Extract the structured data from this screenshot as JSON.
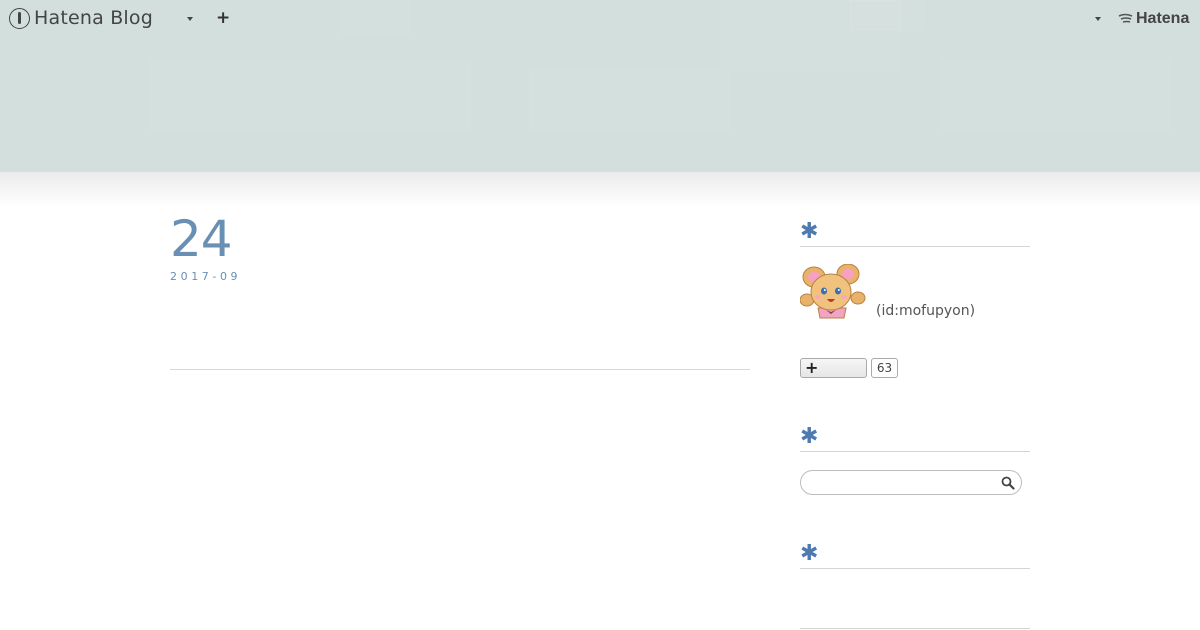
{
  "globalbar": {
    "logo_text": "Hatena Blog",
    "plus_label": "+",
    "brand_text": "Hatena"
  },
  "entry": {
    "day": "24",
    "year_month": "2017-09"
  },
  "profile": {
    "id_text": "(id:mofupyon)",
    "follow_label": "+",
    "follow_count": "63"
  },
  "search": {
    "value": "",
    "placeholder": ""
  },
  "colors": {
    "header_bg": "#d2dfdd",
    "accent": "#6a8fb5",
    "asterisk": "#4d7bb0"
  },
  "icons": [
    "hatena-blog-logo-icon",
    "caret-down-icon",
    "plus-icon",
    "hatena-logo-icon",
    "asterisk-icon",
    "search-icon"
  ]
}
